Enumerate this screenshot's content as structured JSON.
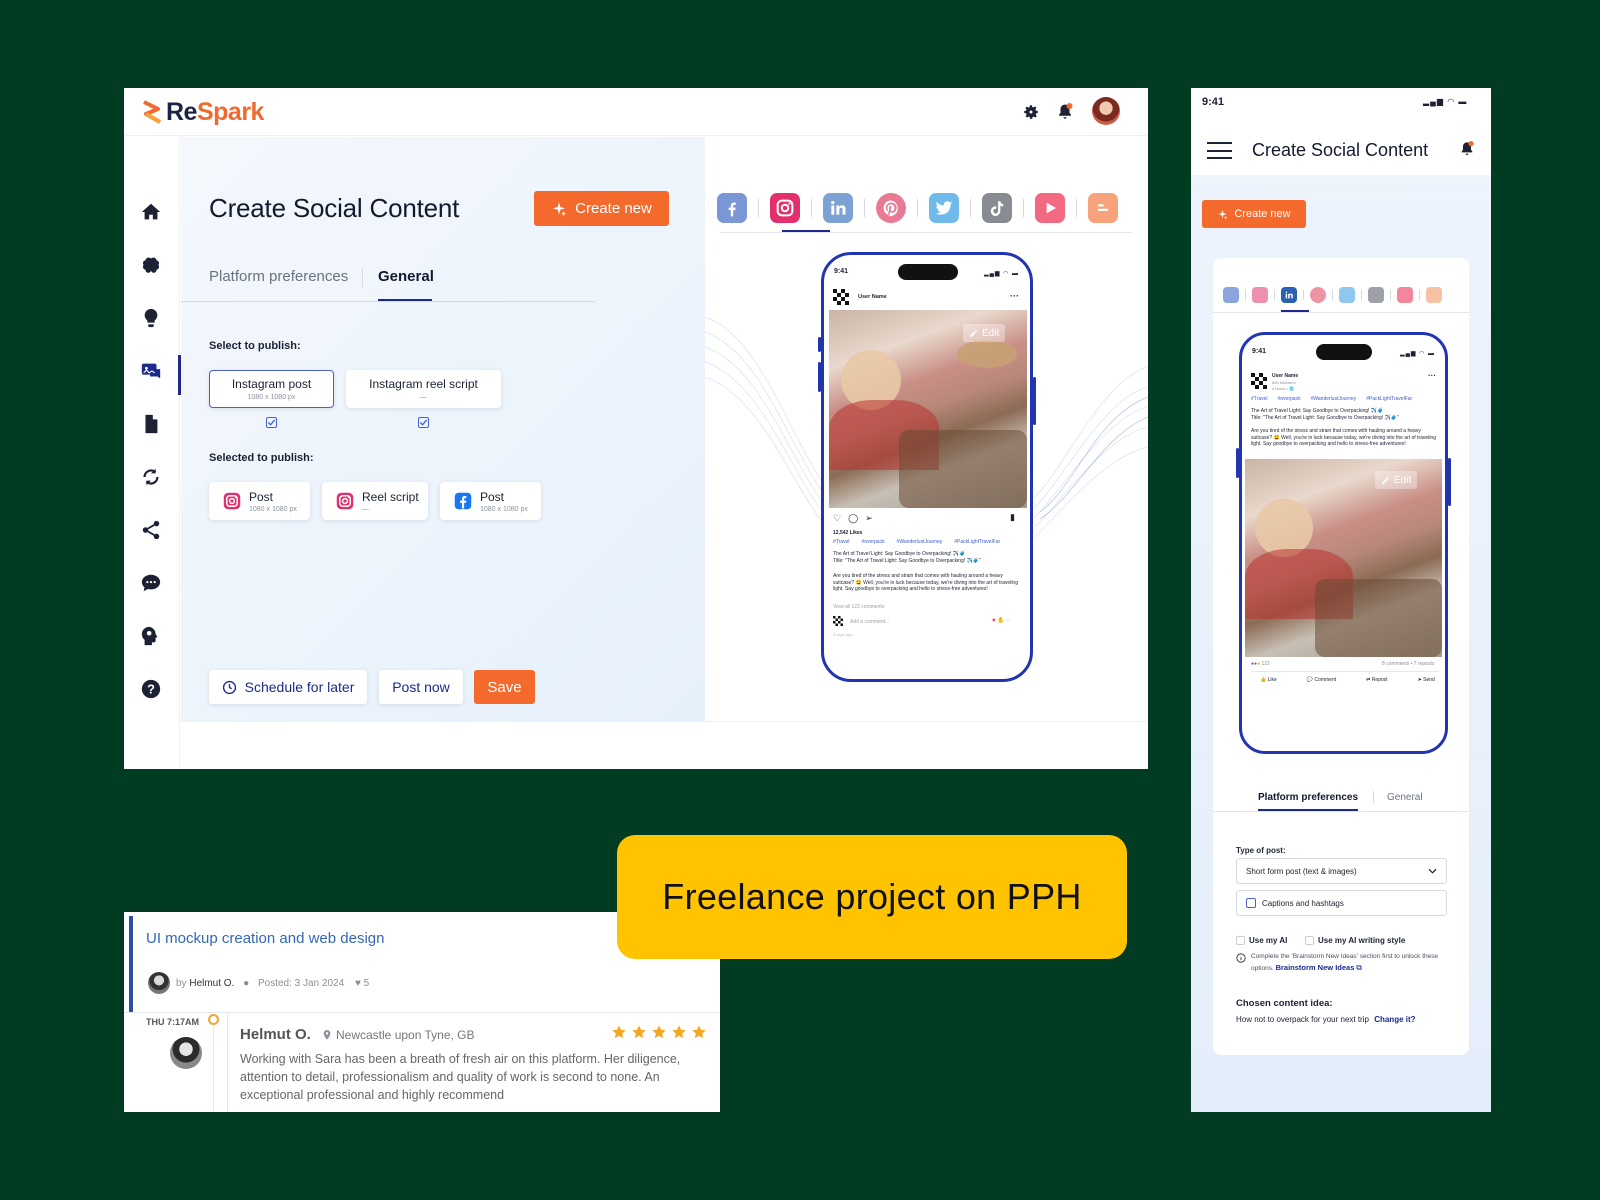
{
  "colors": {
    "background": "#003b22",
    "accent": "#f36a2c",
    "primary": "#1d2a8c",
    "banner": "#ffc300"
  },
  "desktop": {
    "logo": {
      "re": "Re",
      "spark": "Spark"
    },
    "header_icons": [
      "gear-icon",
      "bell-icon",
      "avatar"
    ],
    "sidebar_icons": [
      "home-icon",
      "brain-icon",
      "lightbulb-icon",
      "social-content-icon",
      "document-icon",
      "repurpose-icon",
      "share-icon",
      "chat-icon",
      "head-idea-icon",
      "help-icon"
    ],
    "title": "Create Social Content",
    "create_new": "Create new",
    "tabs": {
      "platform": "Platform preferences",
      "general": "General",
      "active": "General"
    },
    "select_label": "Select to publish:",
    "options": [
      {
        "title": "Instagram post",
        "sub": "1080 x 1080 px",
        "checked": true
      },
      {
        "title": "Instagram reel script",
        "sub": "—",
        "checked": true
      }
    ],
    "selected_label": "Selected to publish:",
    "selected": [
      {
        "title": "Post",
        "sub": "1080 x 1080 px",
        "platform": "instagram"
      },
      {
        "title": "Reel script",
        "sub": "—",
        "platform": "instagram"
      },
      {
        "title": "Post",
        "sub": "1080 x 1080 px",
        "platform": "facebook"
      }
    ],
    "actions": {
      "schedule": "Schedule for later",
      "post_now": "Post now",
      "save": "Save"
    },
    "platforms": [
      "facebook",
      "instagram",
      "linkedin",
      "pinterest",
      "twitter",
      "tiktok",
      "youtube",
      "blogger"
    ],
    "active_platform": "instagram",
    "phone": {
      "time": "9:41",
      "user": "User Name",
      "edit": "Edit",
      "likes": "12,542 Likes",
      "hashtags": [
        "#Travel",
        "#overpack",
        "#WanderlustJourney",
        "#PackLightTravelFar"
      ],
      "caption1": "The Art of Travel Light: Say Goodbye to Overpacking! ✈️🧳",
      "caption2": "Title: \"The Art of Travel Light: Say Goodbye to Overpacking! ✈️🧳\"",
      "body": "Are you tired of the stress and strain that comes with hauling around a heavy suitcase? 😩 Well, you're in luck because today, we're diving into the art of traveling light. Say goodbye to overpacking and hello to stress-free adventures!",
      "view_comments": "View all 122 comments",
      "add_comment": "Add a comment...",
      "ago": "5 days ago"
    }
  },
  "mobile": {
    "time": "9:41",
    "title": "Create Social Content",
    "create_new": "Create new",
    "active_platform": "linkedin",
    "phone": {
      "time": "9:41",
      "user": "User Name",
      "followers": "650 followers",
      "meta": "4 hours • 🌐",
      "hashtags": [
        "#Travel",
        "#overpack",
        "#WanderlustJourney",
        "#PackLightTravelFar"
      ],
      "caption1": "The Art of Travel Light: Say Goodbye to Overpacking! ✈️🧳",
      "caption2": "Title: \"The Art of Travel Light: Say Goodbye to Overpacking! ✈️🧳\"",
      "body": "Are you tired of the stress and strain that comes with hauling around a heavy suitcase? 😩 Well, you're in luck because today, we're diving into the art of traveling light. Say goodbye to overpacking and hello to stress-free adventures!",
      "edit": "Edit",
      "reactions": "122",
      "comments": "8 comments • 7 reposts",
      "actions": [
        "Like",
        "Comment",
        "Repost",
        "Send"
      ]
    },
    "tabs": {
      "platform": "Platform preferences",
      "general": "General",
      "active": "Platform preferences"
    },
    "type_label": "Type of post:",
    "type_value": "Short form post (text & images)",
    "captions": "Captions and hashtags",
    "use_ai": "Use my AI",
    "use_ai_style": "Use my AI writing style",
    "info_text": "Complete the 'Brainstorm New Ideas' section first to unlock these options.",
    "brainstorm_link": "Brainstorm New Ideas",
    "chosen_label": "Chosen content idea:",
    "chosen_value": "How not to overpack for your next trip",
    "change": "Change it?"
  },
  "review": {
    "title": "UI mockup creation and web design",
    "by": "by",
    "author": "Helmut O.",
    "posted": "Posted: 3 Jan 2024",
    "likes": "5",
    "time": "THU 7:17AM",
    "name": "Helmut O.",
    "location": "Newcastle upon Tyne, GB",
    "rating": 5,
    "text": "Working with Sara has been a breath of fresh air on this platform. Her diligence, attention to detail, professionalism and quality of work is second to none. An exceptional professional and highly recommend"
  },
  "banner": {
    "text": "Freelance project on PPH"
  }
}
